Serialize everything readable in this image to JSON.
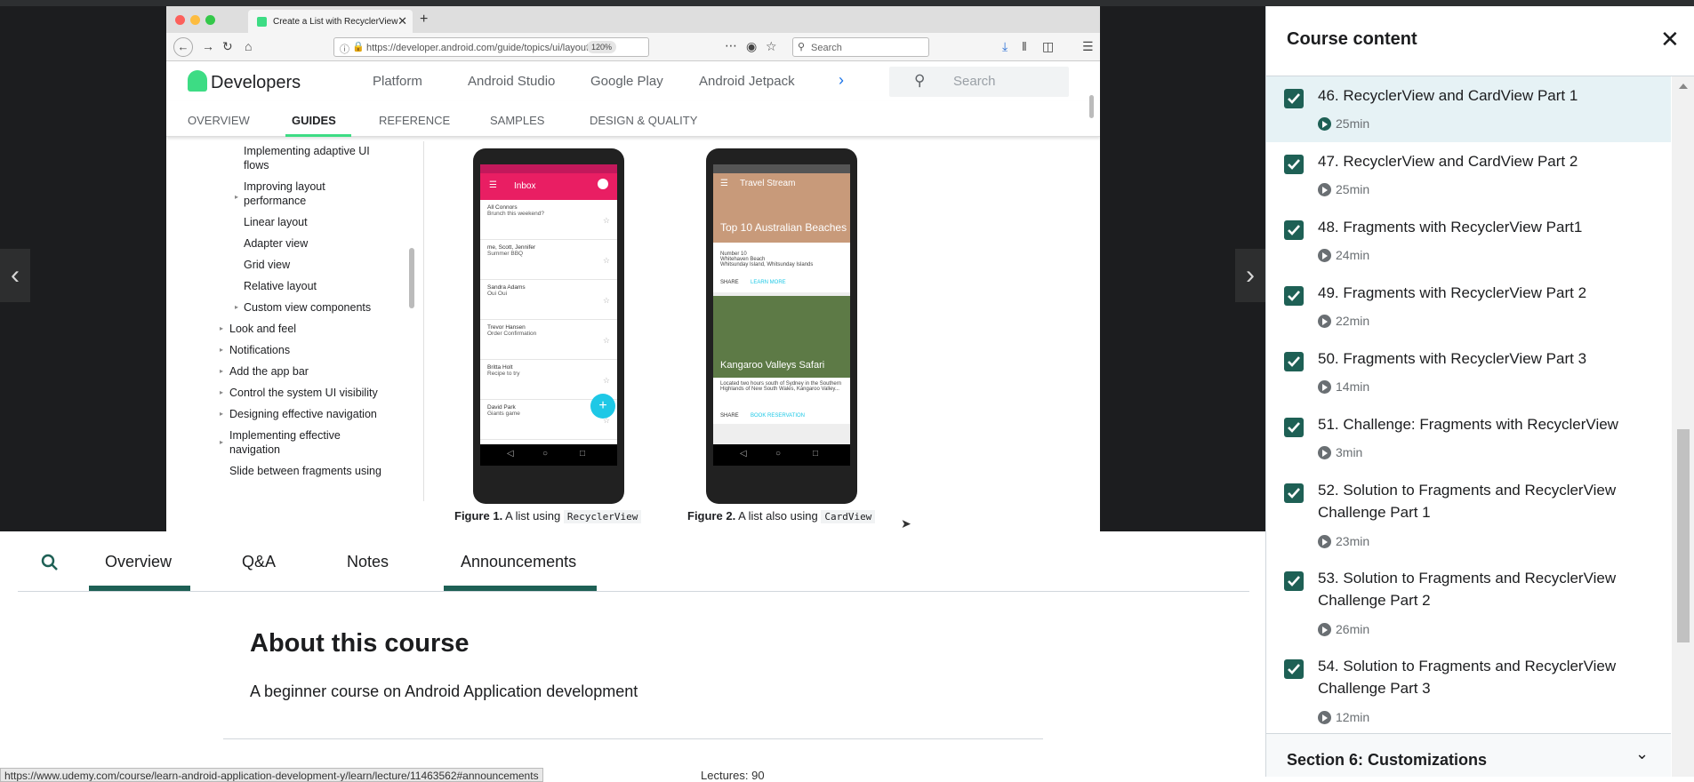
{
  "browser": {
    "tab_title": "Create a List with RecyclerView",
    "url": "https://developer.android.com/guide/topics/ui/layout/",
    "zoom": "120%",
    "search_placeholder": "Search"
  },
  "dev_site": {
    "logo": "Developers",
    "nav": [
      "Platform",
      "Android Studio",
      "Google Play",
      "Android Jetpack"
    ],
    "search_placeholder": "Search",
    "tabs": [
      "OVERVIEW",
      "GUIDES",
      "REFERENCE",
      "SAMPLES",
      "DESIGN & QUALITY"
    ],
    "sidebar": [
      "Implementing adaptive UI flows",
      "Improving layout performance",
      "Linear layout",
      "Adapter view",
      "Grid view",
      "Relative layout",
      "Custom view components",
      "Look and feel",
      "Notifications",
      "Add the app bar",
      "Control the system UI visibility",
      "Designing effective navigation",
      "Implementing effective navigation",
      "Slide between fragments using"
    ],
    "phone1": {
      "header": "Inbox",
      "items": [
        {
          "title": "All Connors",
          "sub": "Brunch this weekend?"
        },
        {
          "title": "me, Scott, Jennifer",
          "sub": "Summer BBQ"
        },
        {
          "title": "Sandra Adams",
          "sub": "Oui Oui"
        },
        {
          "title": "Trevor Hansen",
          "sub": "Order Confirmation"
        },
        {
          "title": "Britta Holt",
          "sub": "Recipe to try"
        },
        {
          "title": "David Park",
          "sub": "Giants game"
        }
      ]
    },
    "phone2": {
      "header": "Travel Stream",
      "card1_title": "Top 10 Australian Beaches",
      "card1_text": "Number 10\nWhitehaven Beach\nWhitsunday Island, Whitsunday Islands",
      "card1_actions": [
        "SHARE",
        "LEARN MORE"
      ],
      "card2_title": "Kangaroo Valleys Safari",
      "card2_text": "Located two hours south of Sydney in the Southern Highlands of New South Wales, Kangaroo Valley...",
      "card2_actions": [
        "SHARE",
        "BOOK RESERVATION"
      ]
    },
    "figure1": {
      "label": "Figure 1.",
      "text": "A list using",
      "code": "RecyclerView"
    },
    "figure2": {
      "label": "Figure 2.",
      "text": "A list also using",
      "code": "CardView"
    }
  },
  "course_tabs": [
    "Overview",
    "Q&A",
    "Notes",
    "Announcements"
  ],
  "about": {
    "title": "About this course",
    "description": "A beginner course on Android Application development"
  },
  "status_url": "https://www.udemy.com/course/learn-android-application-development-y/learn/lecture/11463562#announcements",
  "lectures_peek": "Lectures: 90",
  "panel": {
    "title": "Course content",
    "lessons": [
      {
        "title": "46. RecyclerView and CardView Part 1",
        "duration": "25min"
      },
      {
        "title": "47. RecyclerView and CardView Part 2",
        "duration": "25min"
      },
      {
        "title": "48. Fragments with RecyclerView Part1",
        "duration": "24min"
      },
      {
        "title": "49. Fragments with RecyclerView Part 2",
        "duration": "22min"
      },
      {
        "title": "50. Fragments with RecyclerView Part 3",
        "duration": "14min"
      },
      {
        "title": "51. Challenge: Fragments with RecyclerView",
        "duration": "3min"
      },
      {
        "title": "52. Solution to Fragments and RecyclerView Challenge Part 1",
        "duration": "23min"
      },
      {
        "title": "53. Solution to Fragments and RecyclerView Challenge Part 2",
        "duration": "26min"
      },
      {
        "title": "54. Solution to Fragments and RecyclerView Challenge Part 3",
        "duration": "12min"
      }
    ],
    "section": "Section 6: Customizations"
  },
  "colors": {
    "accent": "#1e6055",
    "current_lesson_bg": "#e6f2f5",
    "android_green": "#3ddc84",
    "inbox_pink": "#e91e63"
  }
}
